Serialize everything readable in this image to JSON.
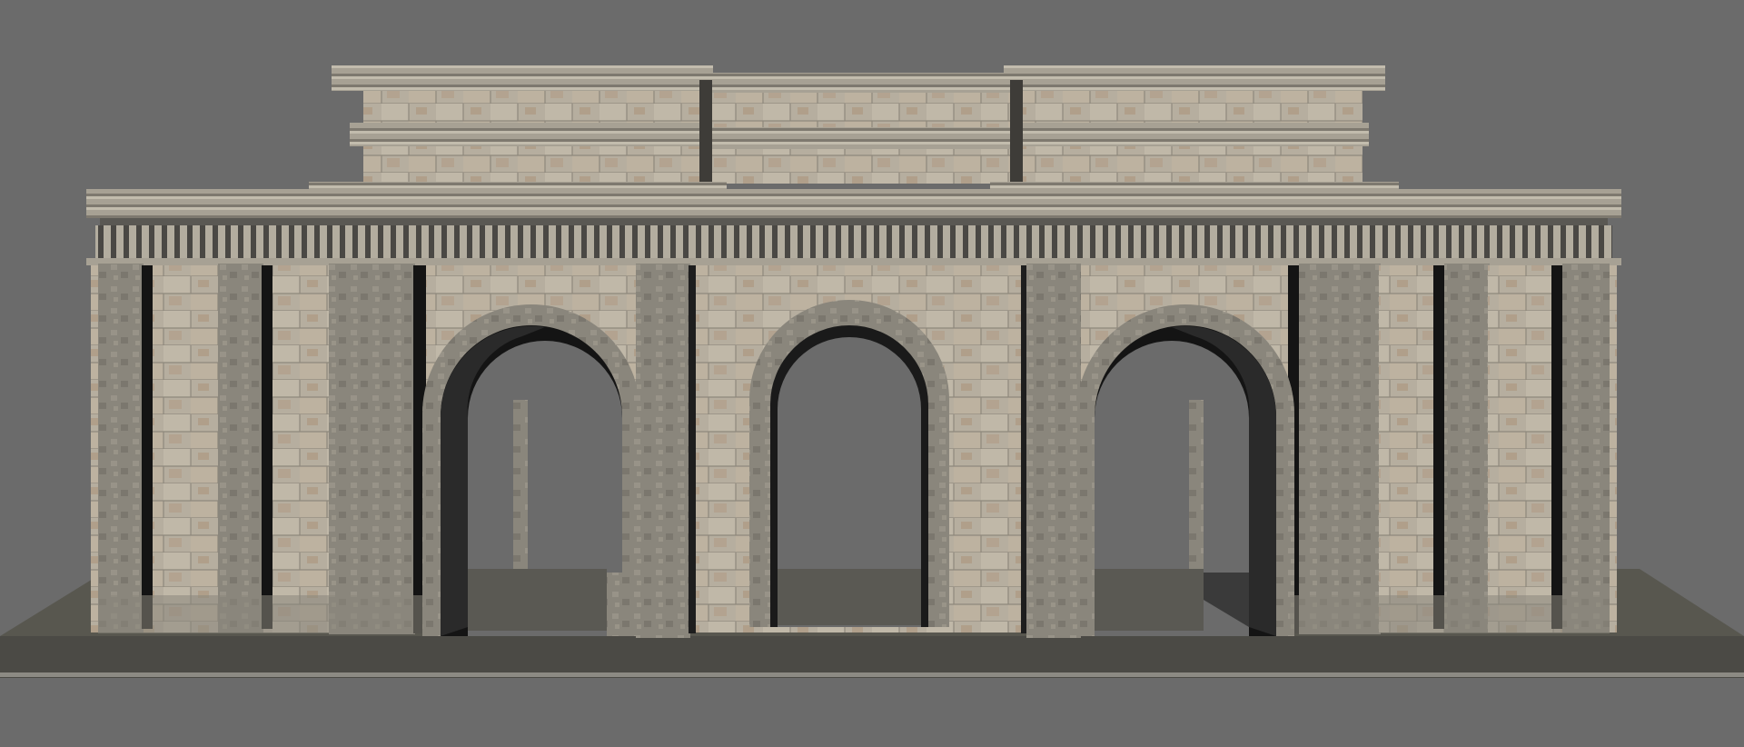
{
  "scene": {
    "subject": "stone-triple-arch-gateway",
    "colors": {
      "background": "#6b6b6b",
      "ground": "#5b5a57",
      "stone_light": "#b9b2a6",
      "stone_mid": "#9e988c",
      "stone_dark": "#7b776e",
      "shadow": "#141414",
      "rust": "#a98c72"
    },
    "arches": [
      {
        "name": "left-arch"
      },
      {
        "name": "center-arch"
      },
      {
        "name": "right-arch"
      }
    ]
  }
}
